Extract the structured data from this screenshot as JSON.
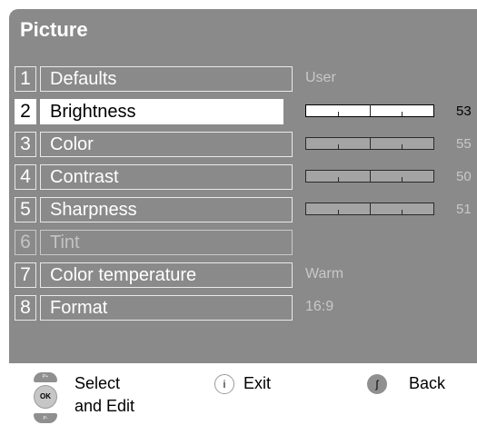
{
  "menu": {
    "title": "Picture",
    "items": [
      {
        "number": "1",
        "label": "Defaults",
        "value": "User",
        "state": "normal",
        "kind": "text"
      },
      {
        "number": "2",
        "label": "Brightness",
        "value": "53",
        "level": 53,
        "state": "selected",
        "kind": "slider"
      },
      {
        "number": "3",
        "label": "Color",
        "value": "55",
        "level": 55,
        "state": "normal",
        "kind": "slider"
      },
      {
        "number": "4",
        "label": "Contrast",
        "value": "50",
        "level": 50,
        "state": "normal",
        "kind": "slider"
      },
      {
        "number": "5",
        "label": "Sharpness",
        "value": "51",
        "level": 51,
        "state": "normal",
        "kind": "slider"
      },
      {
        "number": "6",
        "label": "Tint",
        "value": "",
        "state": "disabled",
        "kind": "none"
      },
      {
        "number": "7",
        "label": "Color temperature",
        "value": "Warm",
        "state": "normal",
        "kind": "text"
      },
      {
        "number": "8",
        "label": "Format",
        "value": "16:9",
        "state": "normal",
        "kind": "text"
      }
    ]
  },
  "footer": {
    "nav_up_label": "P+",
    "ok_label": "OK",
    "nav_down_label": "P-",
    "select_line1": "Select",
    "select_line2": "and Edit",
    "info_icon": "i",
    "exit_label": "Exit",
    "back_label": "Back"
  },
  "colors": {
    "panel": "#8a8a8a",
    "selected_row": "#ffffff",
    "inactive_text": "#c8c8c8"
  }
}
